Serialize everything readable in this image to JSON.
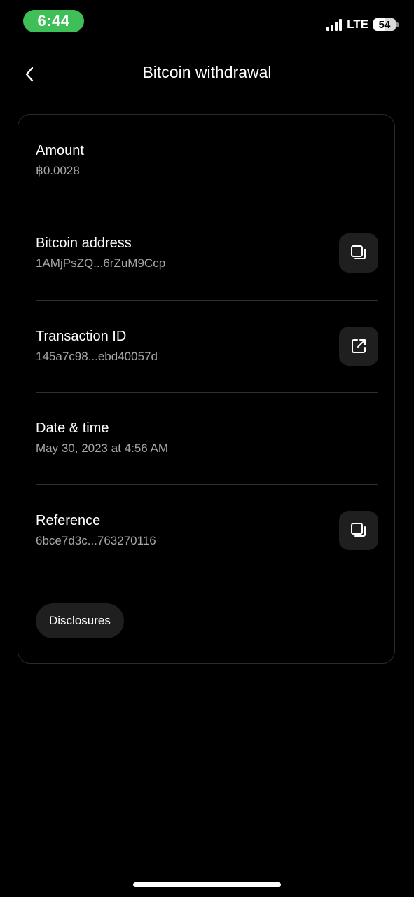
{
  "status_bar": {
    "time": "6:44",
    "network": "LTE",
    "battery": "54",
    "battery_level": 0.54,
    "pill_color": "#3fbf57"
  },
  "header": {
    "title": "Bitcoin withdrawal",
    "back_icon": "chevron-left-icon"
  },
  "details": {
    "amount": {
      "label": "Amount",
      "value": "฿0.0028"
    },
    "bitcoin_address": {
      "label": "Bitcoin address",
      "value": "1AMjPsZQ...6rZuM9Ccp",
      "action_icon": "copy-icon"
    },
    "transaction_id": {
      "label": "Transaction ID",
      "value": "145a7c98...ebd40057d",
      "action_icon": "external-link-icon"
    },
    "date_time": {
      "label": "Date & time",
      "value": "May 30, 2023 at 4:56 AM"
    },
    "reference": {
      "label": "Reference",
      "value": "6bce7d3c...763270116",
      "action_icon": "copy-icon"
    }
  },
  "disclosures_label": "Disclosures"
}
